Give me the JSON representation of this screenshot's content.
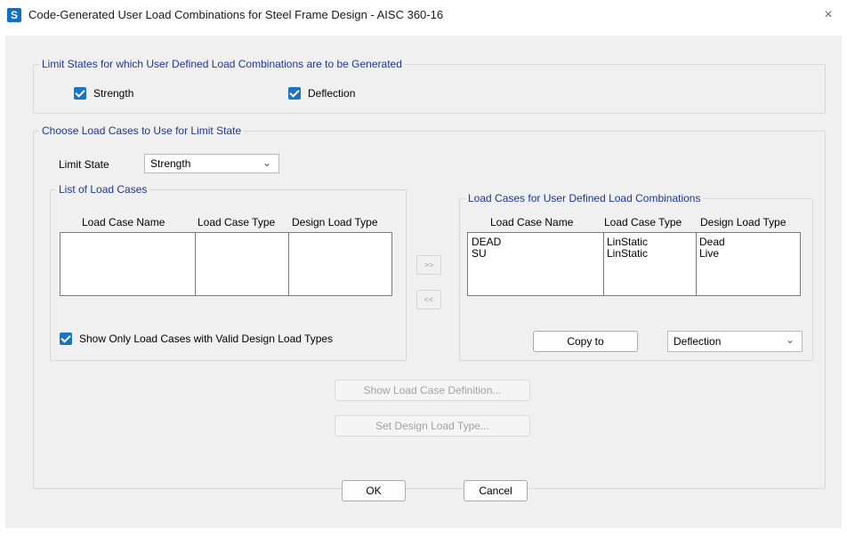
{
  "window": {
    "icon_letter": "S",
    "title": "Code-Generated User Load Combinations for Steel Frame Design - AISC 360-16",
    "close_glyph": "×"
  },
  "limit_states_group": {
    "legend": "Limit States for which User Defined Load Combinations are to be Generated",
    "strength": {
      "label": "Strength",
      "checked": true
    },
    "deflection": {
      "label": "Deflection",
      "checked": true
    }
  },
  "load_cases_group": {
    "legend": "Choose Load Cases to Use for Limit State",
    "limit_state_label": "Limit State",
    "limit_state_value": "Strength",
    "list_group": {
      "legend": "List of Load Cases",
      "columns": [
        "Load Case Name",
        "Load Case Type",
        "Design Load Type"
      ],
      "rows": []
    },
    "move_right_label": ">>",
    "move_left_label": "<<",
    "selected_group": {
      "legend": "Load Cases for User Defined Load Combinations",
      "columns": [
        "Load Case Name",
        "Load Case Type",
        "Design Load Type"
      ],
      "rows": [
        {
          "name": "DEAD",
          "type": "LinStatic",
          "design": "Dead"
        },
        {
          "name": "SU",
          "type": "LinStatic",
          "design": "Live"
        }
      ],
      "copy_to_label": "Copy to",
      "copy_target": "Deflection"
    },
    "show_only_valid": {
      "label": "Show Only Load Cases with Valid Design Load Types",
      "checked": true
    },
    "show_definition_label": "Show Load Case Definition...",
    "set_design_type_label": "Set Design Load Type..."
  },
  "footer": {
    "ok_label": "OK",
    "cancel_label": "Cancel"
  },
  "colors": {
    "legend_text": "#1a3799",
    "checkbox_accent": "#1a73c7",
    "app_icon": "#0e6fc7"
  },
  "icons": {
    "app": "sap2000-s-icon",
    "close": "close-icon",
    "dropdown": "chevron-down-icon",
    "checkbox": "checkmark-icon"
  }
}
